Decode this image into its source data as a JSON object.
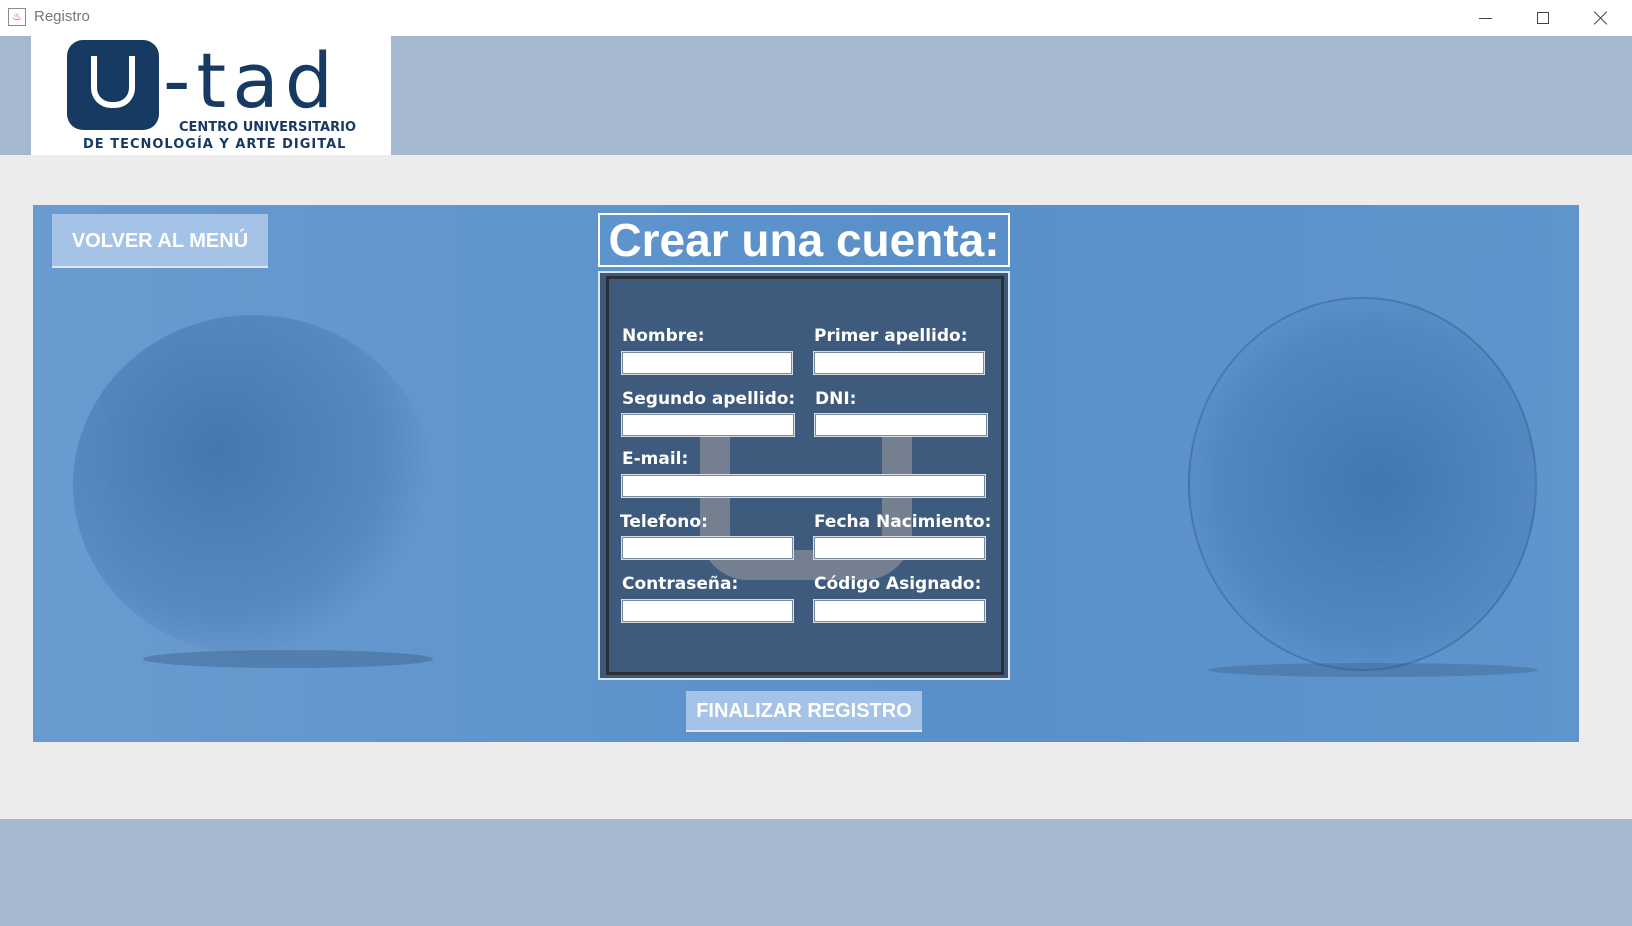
{
  "window": {
    "title": "Registro",
    "app_icon": "java-icon",
    "controls": [
      "minimize-icon",
      "maximize-icon",
      "close-icon"
    ]
  },
  "logo": {
    "word": "U-Tad",
    "line1": "CENTRO UNIVERSITARIO",
    "line2": "DE TECNOLOGÍA Y ARTE DIGITAL"
  },
  "nav": {
    "back_label": "VOLVER AL MENÚ"
  },
  "form": {
    "title": "Crear una cuenta:",
    "fields": {
      "nombre": {
        "label": "Nombre:",
        "value": ""
      },
      "primer_apellido": {
        "label": "Primer apellido:",
        "value": ""
      },
      "segundo_apellido": {
        "label": "Segundo apellido:",
        "value": ""
      },
      "dni": {
        "label": "DNI:",
        "value": ""
      },
      "email": {
        "label": "E-mail:",
        "value": ""
      },
      "telefono": {
        "label": "Telefono:",
        "value": ""
      },
      "fecha_nacimiento": {
        "label": "Fecha Nacimiento:",
        "value": ""
      },
      "contrasena": {
        "label": "Contraseña:",
        "value": ""
      },
      "codigo_asignado": {
        "label": "Código Asignado:",
        "value": ""
      }
    },
    "submit_label": "FINALIZAR REGISTRO"
  },
  "colors": {
    "header_band": "#a5b8cf",
    "banner": "#5c92cb",
    "form_panel": "#3e5a7c",
    "button": "#a4c3e6",
    "logo_blue": "#173a63"
  }
}
